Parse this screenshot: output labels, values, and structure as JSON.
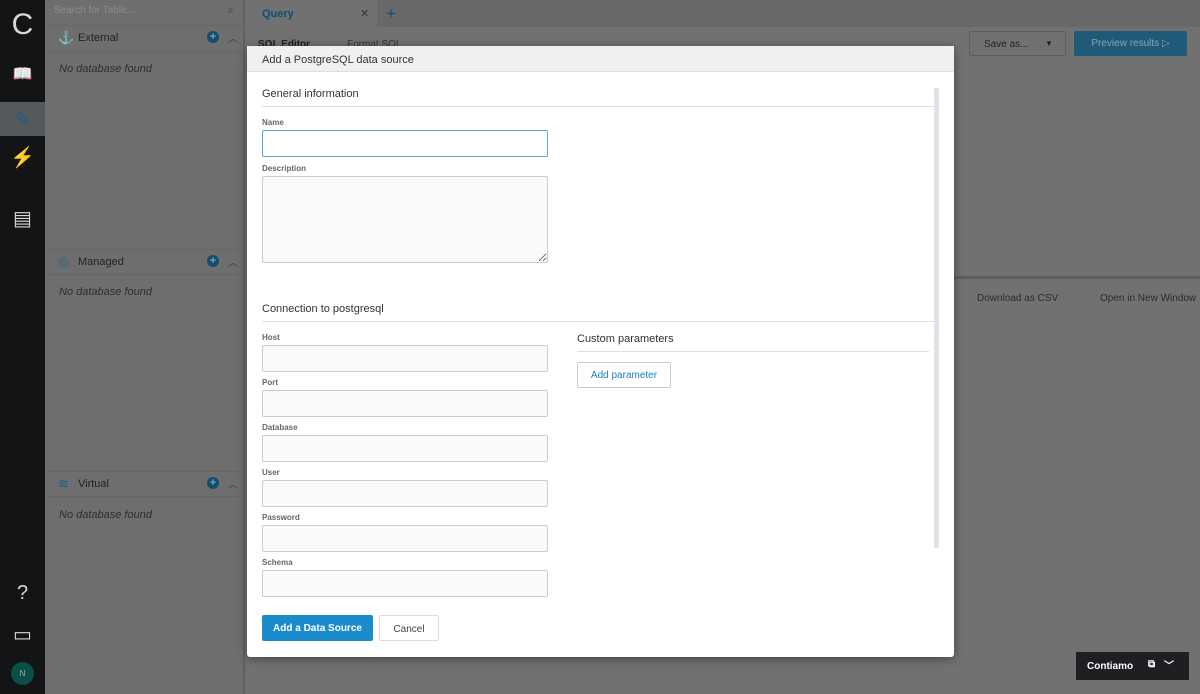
{
  "rail": {
    "avatar": "N"
  },
  "sidebar": {
    "search_placeholder": "Search for Table...",
    "sections": [
      {
        "label": "External",
        "empty": "No database found"
      },
      {
        "label": "Managed",
        "empty": "No database found"
      },
      {
        "label": "Virtual",
        "empty": "No database found"
      }
    ]
  },
  "tabs": {
    "query": "Query"
  },
  "toolbar": {
    "sql_editor": "SQL Editor",
    "format_sql": "Format SQL",
    "save_as": "Save as...",
    "preview": "Preview results"
  },
  "results": {
    "download_csv": "Download as CSV",
    "open_new_window": "Open in New Window"
  },
  "modal": {
    "title": "Add a PostgreSQL data source",
    "general": "General information",
    "name_label": "Name",
    "name_value": "",
    "description_label": "Description",
    "connection": "Connection to postgresql",
    "host": "Host",
    "port": "Port",
    "database": "Database",
    "user": "User",
    "password": "Password",
    "schema": "Schema",
    "custom": "Custom parameters",
    "add_param": "Add parameter",
    "submit": "Add a Data Source",
    "cancel": "Cancel"
  },
  "widget": {
    "label": "Contiamo"
  }
}
